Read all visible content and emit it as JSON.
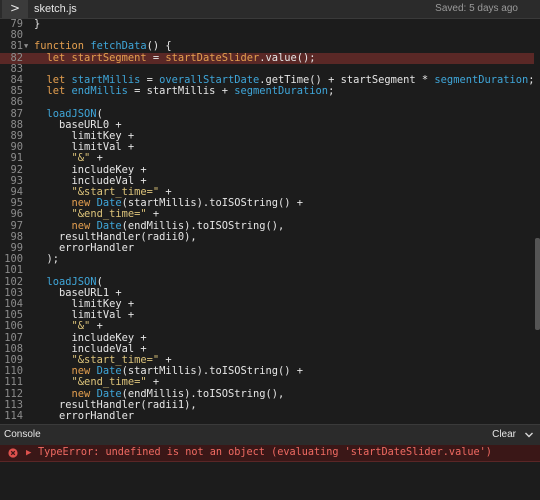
{
  "window": {
    "toggle_glyph": ">",
    "filename": "sketch.js",
    "saved_status": "Saved: 5 days ago"
  },
  "editor": {
    "highlight_line": "82",
    "lines": [
      {
        "n": "79",
        "fold": false,
        "tokens": [
          {
            "t": "}",
            "c": "plain"
          }
        ]
      },
      {
        "n": "80",
        "fold": false,
        "tokens": []
      },
      {
        "n": "81",
        "fold": true,
        "tokens": [
          {
            "t": "function ",
            "c": "kw"
          },
          {
            "t": "fetchData",
            "c": "fn"
          },
          {
            "t": "() {",
            "c": "plain"
          }
        ]
      },
      {
        "n": "82",
        "fold": false,
        "tokens": [
          {
            "t": "  ",
            "c": "plain"
          },
          {
            "t": "let ",
            "c": "kw"
          },
          {
            "t": "startSegment",
            "c": "vartx"
          },
          {
            "t": " = ",
            "c": "plain"
          },
          {
            "t": "startDateSlider",
            "c": "vartx"
          },
          {
            "t": ".value();",
            "c": "plain"
          }
        ]
      },
      {
        "n": "83",
        "fold": false,
        "tokens": []
      },
      {
        "n": "84",
        "fold": false,
        "tokens": [
          {
            "t": "  ",
            "c": "plain"
          },
          {
            "t": "let ",
            "c": "kw"
          },
          {
            "t": "startMillis",
            "c": "fn"
          },
          {
            "t": " = ",
            "c": "plain"
          },
          {
            "t": "overallStartDate",
            "c": "fn"
          },
          {
            "t": ".getTime() + startSegment * ",
            "c": "plain"
          },
          {
            "t": "segmentDuration",
            "c": "fn"
          },
          {
            "t": ";",
            "c": "plain"
          }
        ]
      },
      {
        "n": "85",
        "fold": false,
        "tokens": [
          {
            "t": "  ",
            "c": "plain"
          },
          {
            "t": "let ",
            "c": "kw"
          },
          {
            "t": "endMillis",
            "c": "fn"
          },
          {
            "t": " = startMillis + ",
            "c": "plain"
          },
          {
            "t": "segmentDuration",
            "c": "fn"
          },
          {
            "t": ";",
            "c": "plain"
          }
        ]
      },
      {
        "n": "86",
        "fold": false,
        "tokens": []
      },
      {
        "n": "87",
        "fold": false,
        "tokens": [
          {
            "t": "  ",
            "c": "plain"
          },
          {
            "t": "loadJSON",
            "c": "fn"
          },
          {
            "t": "(",
            "c": "plain"
          }
        ]
      },
      {
        "n": "88",
        "fold": false,
        "tokens": [
          {
            "t": "    baseURL0 +",
            "c": "plain"
          }
        ]
      },
      {
        "n": "89",
        "fold": false,
        "tokens": [
          {
            "t": "      limitKey +",
            "c": "plain"
          }
        ]
      },
      {
        "n": "90",
        "fold": false,
        "tokens": [
          {
            "t": "      limitVal +",
            "c": "plain"
          }
        ]
      },
      {
        "n": "91",
        "fold": false,
        "tokens": [
          {
            "t": "      ",
            "c": "plain"
          },
          {
            "t": "\"&\"",
            "c": "str"
          },
          {
            "t": " +",
            "c": "plain"
          }
        ]
      },
      {
        "n": "92",
        "fold": false,
        "tokens": [
          {
            "t": "      includeKey +",
            "c": "plain"
          }
        ]
      },
      {
        "n": "93",
        "fold": false,
        "tokens": [
          {
            "t": "      includeVal +",
            "c": "plain"
          }
        ]
      },
      {
        "n": "94",
        "fold": false,
        "tokens": [
          {
            "t": "      ",
            "c": "plain"
          },
          {
            "t": "\"&start_time=\"",
            "c": "str"
          },
          {
            "t": " +",
            "c": "plain"
          }
        ]
      },
      {
        "n": "95",
        "fold": false,
        "tokens": [
          {
            "t": "      ",
            "c": "plain"
          },
          {
            "t": "new ",
            "c": "kw"
          },
          {
            "t": "Date",
            "c": "fn"
          },
          {
            "t": "(startMillis).toISOString() +",
            "c": "plain"
          }
        ]
      },
      {
        "n": "96",
        "fold": false,
        "tokens": [
          {
            "t": "      ",
            "c": "plain"
          },
          {
            "t": "\"&end_time=\"",
            "c": "str"
          },
          {
            "t": " +",
            "c": "plain"
          }
        ]
      },
      {
        "n": "97",
        "fold": false,
        "tokens": [
          {
            "t": "      ",
            "c": "plain"
          },
          {
            "t": "new ",
            "c": "kw"
          },
          {
            "t": "Date",
            "c": "fn"
          },
          {
            "t": "(endMillis).toISOString(),",
            "c": "plain"
          }
        ]
      },
      {
        "n": "98",
        "fold": false,
        "tokens": [
          {
            "t": "    resultHandler(radii0),",
            "c": "plain"
          }
        ]
      },
      {
        "n": "99",
        "fold": false,
        "tokens": [
          {
            "t": "    errorHandler",
            "c": "plain"
          }
        ]
      },
      {
        "n": "100",
        "fold": false,
        "tokens": [
          {
            "t": "  );",
            "c": "plain"
          }
        ]
      },
      {
        "n": "101",
        "fold": false,
        "tokens": []
      },
      {
        "n": "102",
        "fold": false,
        "tokens": [
          {
            "t": "  ",
            "c": "plain"
          },
          {
            "t": "loadJSON",
            "c": "fn"
          },
          {
            "t": "(",
            "c": "plain"
          }
        ]
      },
      {
        "n": "103",
        "fold": false,
        "tokens": [
          {
            "t": "    baseURL1 +",
            "c": "plain"
          }
        ]
      },
      {
        "n": "104",
        "fold": false,
        "tokens": [
          {
            "t": "      limitKey +",
            "c": "plain"
          }
        ]
      },
      {
        "n": "105",
        "fold": false,
        "tokens": [
          {
            "t": "      limitVal +",
            "c": "plain"
          }
        ]
      },
      {
        "n": "106",
        "fold": false,
        "tokens": [
          {
            "t": "      ",
            "c": "plain"
          },
          {
            "t": "\"&\"",
            "c": "str"
          },
          {
            "t": " +",
            "c": "plain"
          }
        ]
      },
      {
        "n": "107",
        "fold": false,
        "tokens": [
          {
            "t": "      includeKey +",
            "c": "plain"
          }
        ]
      },
      {
        "n": "108",
        "fold": false,
        "tokens": [
          {
            "t": "      includeVal +",
            "c": "plain"
          }
        ]
      },
      {
        "n": "109",
        "fold": false,
        "tokens": [
          {
            "t": "      ",
            "c": "plain"
          },
          {
            "t": "\"&start_time=\"",
            "c": "str"
          },
          {
            "t": " +",
            "c": "plain"
          }
        ]
      },
      {
        "n": "110",
        "fold": false,
        "tokens": [
          {
            "t": "      ",
            "c": "plain"
          },
          {
            "t": "new ",
            "c": "kw"
          },
          {
            "t": "Date",
            "c": "fn"
          },
          {
            "t": "(startMillis).toISOString() +",
            "c": "plain"
          }
        ]
      },
      {
        "n": "111",
        "fold": false,
        "tokens": [
          {
            "t": "      ",
            "c": "plain"
          },
          {
            "t": "\"&end_time=\"",
            "c": "str"
          },
          {
            "t": " +",
            "c": "plain"
          }
        ]
      },
      {
        "n": "112",
        "fold": false,
        "tokens": [
          {
            "t": "      ",
            "c": "plain"
          },
          {
            "t": "new ",
            "c": "kw"
          },
          {
            "t": "Date",
            "c": "fn"
          },
          {
            "t": "(endMillis).toISOString(),",
            "c": "plain"
          }
        ]
      },
      {
        "n": "113",
        "fold": false,
        "tokens": [
          {
            "t": "    resultHandler(radii1),",
            "c": "plain"
          }
        ]
      },
      {
        "n": "114",
        "fold": false,
        "tokens": [
          {
            "t": "    errorHandler",
            "c": "plain"
          }
        ]
      }
    ]
  },
  "console": {
    "title": "Console",
    "clear_label": "Clear",
    "error_message": "TypeError: undefined is not an object (evaluating 'startDateSlider.value')"
  },
  "colors": {
    "background": "#1c1c1c",
    "keyword": "#e49f4f",
    "function": "#3fa6d9",
    "string": "#dcc37a",
    "error": "#f06a62",
    "highlight": "#5a2826"
  }
}
